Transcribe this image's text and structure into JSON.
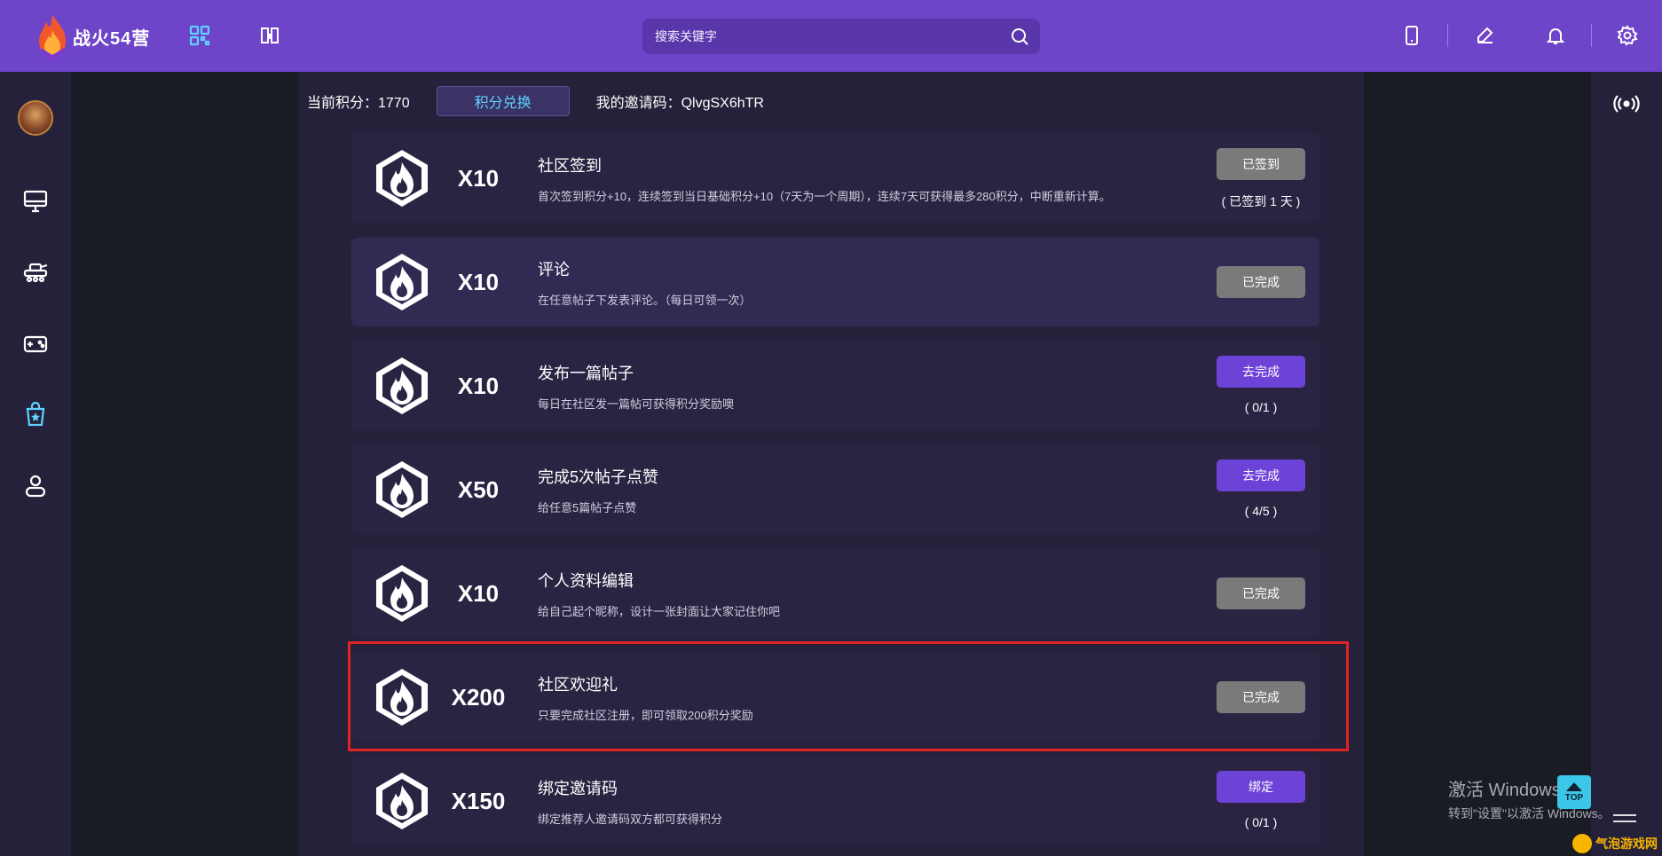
{
  "header": {
    "logo_text": "战火54营",
    "search_placeholder": "搜索关键字",
    "icons": [
      "qrcode-icon",
      "book-icon",
      "mobile-icon",
      "edit-icon",
      "bell-icon",
      "gear-icon"
    ]
  },
  "sidebar": {
    "items": [
      "avatar",
      "monitor-icon",
      "tank-icon",
      "gamepad-icon",
      "task-bag-icon",
      "user-icon"
    ],
    "active": "task-bag-icon"
  },
  "rightbar": {
    "icons": [
      "broadcast-icon"
    ]
  },
  "points": {
    "current_label": "当前积分：1770",
    "exchange_label": "积分兑换",
    "invite_label": "我的邀请码：QlvgSX6hTR"
  },
  "tasks": [
    {
      "multiplier": "X10",
      "title": "社区签到",
      "desc": "首次签到积分+10，连续签到当日基础积分+10（7天为一个周期），连续7天可获得最多280积分，中断重新计算。",
      "button": "已签到",
      "state": "done",
      "progress": "( 已签到 1 天 )"
    },
    {
      "multiplier": "X10",
      "title": "评论",
      "desc": "在任意帖子下发表评论。（每日可领一次）",
      "button": "已完成",
      "state": "done",
      "progress": ""
    },
    {
      "multiplier": "X10",
      "title": "发布一篇帖子",
      "desc": "每日在社区发一篇帖可获得积分奖励噢",
      "button": "去完成",
      "state": "todo",
      "progress": "( 0/1 )"
    },
    {
      "multiplier": "X50",
      "title": "完成5次帖子点赞",
      "desc": "给任意5篇帖子点赞",
      "button": "去完成",
      "state": "todo",
      "progress": "( 4/5 )"
    },
    {
      "multiplier": "X10",
      "title": "个人资料编辑",
      "desc": "给自己起个昵称，设计一张封面让大家记住你吧",
      "button": "已完成",
      "state": "done",
      "progress": ""
    },
    {
      "multiplier": "X200",
      "title": "社区欢迎礼",
      "desc": "只要完成社区注册，即可领取200积分奖励",
      "button": "已完成",
      "state": "done",
      "progress": ""
    },
    {
      "multiplier": "X150",
      "title": "绑定邀请码",
      "desc": "绑定推荐人邀请码双方都可获得积分",
      "button": "绑定",
      "state": "todo",
      "progress": "( 0/1 )"
    }
  ],
  "watermark": {
    "line1": "激活 Windows",
    "line2": "转到\"设置\"以激活 Windows。"
  },
  "top_button": "TOP",
  "site_mark": "气泡游戏网",
  "colors": {
    "accent": "#6e44c9",
    "done_btn": "#7a7a7a",
    "todo_btn": "#6c43d6",
    "highlight": "#e02424"
  }
}
